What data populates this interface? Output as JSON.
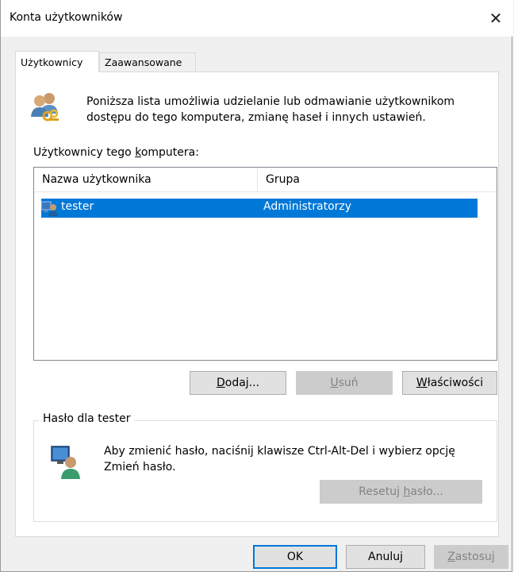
{
  "window": {
    "title": "Konta użytkowników",
    "close_glyph": "✕"
  },
  "tabs": [
    {
      "label": "Użytkownicy",
      "active": true
    },
    {
      "label": "Zaawansowane",
      "active": false
    }
  ],
  "intro": {
    "icon": "users-keys-icon",
    "text": "Poniższa lista umożliwia udzielanie lub odmawianie użytkownikom dostępu do tego komputera, zmianę haseł i innych ustawień."
  },
  "users": {
    "label": "Użytkownicy tego komputera:",
    "columns": [
      "Nazwa użytkownika",
      "Grupa"
    ],
    "rows": [
      {
        "name": "tester",
        "group": "Administratorzy",
        "selected": true,
        "icon": "user-icon"
      }
    ]
  },
  "buttons": {
    "add": {
      "pre": "",
      "u": "D",
      "post": "odaj..."
    },
    "remove": {
      "pre": "",
      "u": "U",
      "post": "suń"
    },
    "properties": {
      "pre": "",
      "u": "W",
      "post": "łaściwości"
    },
    "ok": "OK",
    "cancel": "Anuluj",
    "apply": {
      "pre": "",
      "u": "Z",
      "post": "astosuj"
    },
    "reset": {
      "pre": "Resetuj ",
      "u": "h",
      "post": "asło..."
    }
  },
  "password": {
    "group_title": "Hasło dla tester",
    "text": "Aby zmienić hasło, naciśnij klawisze Ctrl-Alt-Del i wybierz opcję Zmień hasło.",
    "icon": "user-monitor-icon"
  },
  "colors": {
    "selection": "#0078d7",
    "accent": "#0078d7"
  }
}
